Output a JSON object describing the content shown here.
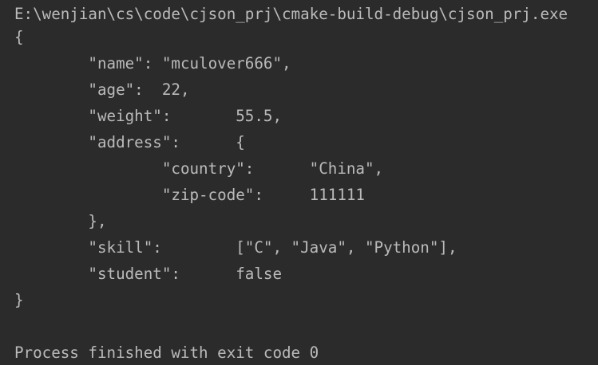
{
  "console": {
    "command_path": "E:\\wenjian\\cs\\code\\cjson_prj\\cmake-build-debug\\cjson_prj.exe",
    "output_lines": [
      "{",
      "\t\"name\": \"mculover666\",",
      "\t\"age\":  22,",
      "\t\"weight\":\t55.5,",
      "\t\"address\":\t{",
      "\t\t\"country\":\t\"China\",",
      "\t\t\"zip-code\":\t111111",
      "\t},",
      "\t\"skill\":\t[\"C\", \"Java\", \"Python\"],",
      "\t\"student\":\tfalse",
      "}"
    ],
    "exit_message": "Process finished with exit code 0"
  },
  "colors": {
    "background": "#2b2b2b",
    "text": "#bbbbbb"
  }
}
